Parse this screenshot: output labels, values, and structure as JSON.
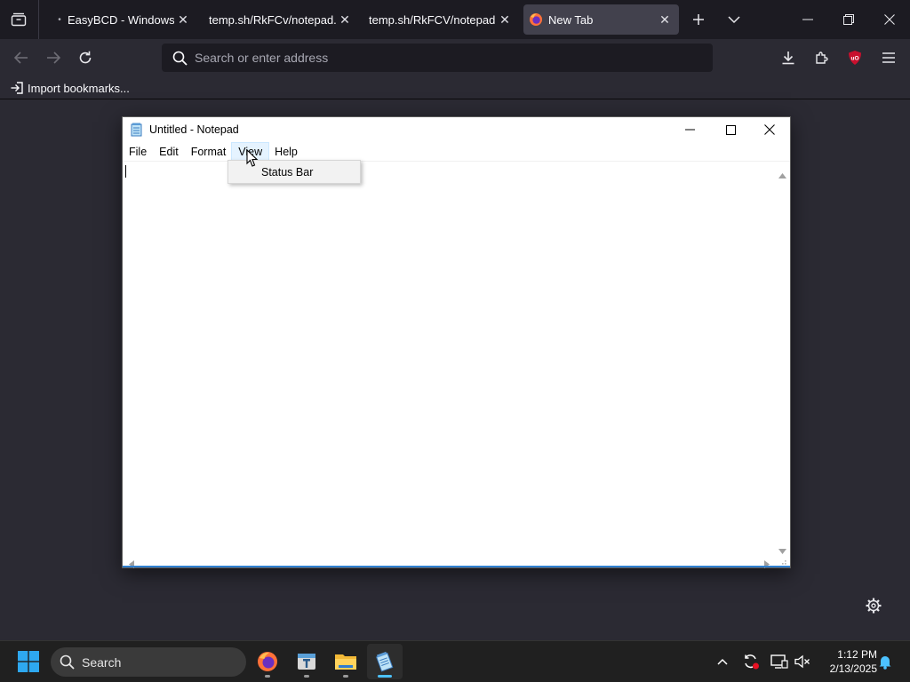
{
  "browser": {
    "tabs": [
      {
        "title": "EasyBCD - Windows Bo",
        "active": false
      },
      {
        "title": "temp.sh/RkFCv/notepad.ex",
        "active": false
      },
      {
        "title": "temp.sh/RkFCV/notepad.ex",
        "active": false
      },
      {
        "title": "New Tab",
        "active": true
      }
    ],
    "address_placeholder": "Search or enter address",
    "bookmarks_import_label": "Import bookmarks..."
  },
  "notepad": {
    "title": "Untitled - Notepad",
    "menu": [
      "File",
      "Edit",
      "Format",
      "View",
      "Help"
    ],
    "open_menu": "View",
    "dropdown_items": [
      "Status Bar"
    ],
    "content": ""
  },
  "taskbar": {
    "search_label": "Search",
    "apps": [
      "firefox",
      "file-explorer-tool",
      "file-explorer",
      "notepad"
    ],
    "time": "1:12 PM",
    "date": "2/13/2025"
  },
  "colors": {
    "browser_bg": "#1c1b22",
    "toolbar_bg": "#2b2a33",
    "accent_blue": "#4cc2ff",
    "ublock_red": "#c8102e"
  }
}
